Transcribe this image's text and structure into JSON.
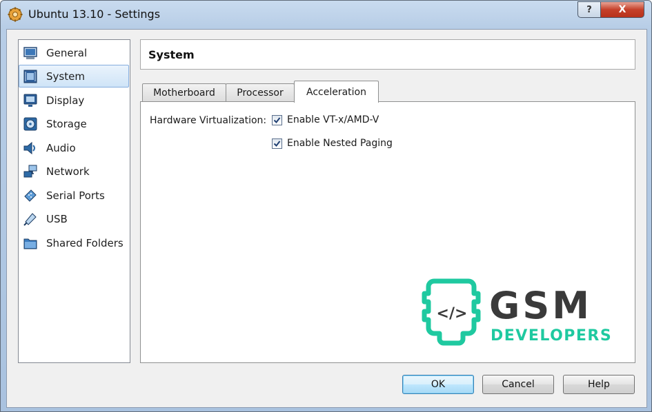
{
  "window": {
    "title": "Ubuntu 13.10 - Settings",
    "help_glyph": "?",
    "close_glyph": "X"
  },
  "sidebar": {
    "items": [
      {
        "label": "General",
        "icon": "monitor-icon",
        "selected": false
      },
      {
        "label": "System",
        "icon": "chip-icon",
        "selected": true
      },
      {
        "label": "Display",
        "icon": "display-icon",
        "selected": false
      },
      {
        "label": "Storage",
        "icon": "disk-icon",
        "selected": false
      },
      {
        "label": "Audio",
        "icon": "speaker-icon",
        "selected": false
      },
      {
        "label": "Network",
        "icon": "network-icon",
        "selected": false
      },
      {
        "label": "Serial Ports",
        "icon": "serial-port-icon",
        "selected": false
      },
      {
        "label": "USB",
        "icon": "usb-icon",
        "selected": false
      },
      {
        "label": "Shared Folders",
        "icon": "folder-icon",
        "selected": false
      }
    ]
  },
  "header": {
    "title": "System"
  },
  "tabs": [
    {
      "label": "Motherboard",
      "active": false
    },
    {
      "label": "Processor",
      "active": false
    },
    {
      "label": "Acceleration",
      "active": true
    }
  ],
  "acceleration": {
    "hw_virt_label": "Hardware Virtualization:",
    "options": [
      {
        "label": "Enable VT-x/AMD-V",
        "checked": true
      },
      {
        "label": "Enable Nested Paging",
        "checked": true
      }
    ]
  },
  "watermark": {
    "line1": "GSM",
    "line2": "DEVELOPERS",
    "code_glyph": "</>",
    "colors": {
      "teal": "#1fc9a0",
      "dark": "#3a3a3a"
    }
  },
  "buttons": {
    "ok": "OK",
    "cancel": "Cancel",
    "help": "Help"
  }
}
